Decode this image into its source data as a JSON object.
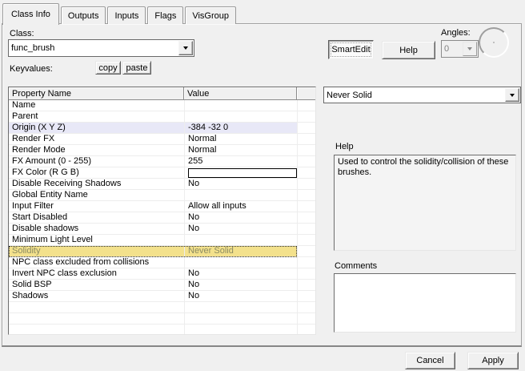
{
  "tabs": [
    {
      "label": "Class Info",
      "active": true
    },
    {
      "label": "Outputs",
      "active": false
    },
    {
      "label": "Inputs",
      "active": false
    },
    {
      "label": "Flags",
      "active": false
    },
    {
      "label": "VisGroup",
      "active": false
    }
  ],
  "class_section": {
    "label": "Class:",
    "value": "func_brush",
    "keyvalues_label": "Keyvalues:",
    "copy_label": "copy",
    "paste_label": "paste"
  },
  "toolbar": {
    "smartedit_label": "SmartEdit",
    "help_label": "Help",
    "angles_label": "Angles:",
    "angles_value": "0"
  },
  "property_table": {
    "columns": [
      "Property Name",
      "Value"
    ],
    "rows": [
      {
        "name": "Name",
        "value": ""
      },
      {
        "name": "Parent",
        "value": ""
      },
      {
        "name": "Origin (X Y Z)",
        "value": "-384 -32 0",
        "highlight": true
      },
      {
        "name": "Render FX",
        "value": "Normal"
      },
      {
        "name": "Render Mode",
        "value": "Normal"
      },
      {
        "name": "FX Amount (0 - 255)",
        "value": "255"
      },
      {
        "name": "FX Color (R G B)",
        "value": "",
        "color_swatch": true
      },
      {
        "name": "Disable Receiving Shadows",
        "value": "No"
      },
      {
        "name": "Global Entity Name",
        "value": ""
      },
      {
        "name": "Input Filter",
        "value": "Allow all inputs"
      },
      {
        "name": "Start Disabled",
        "value": "No"
      },
      {
        "name": "Disable shadows",
        "value": "No"
      },
      {
        "name": "Minimum Light Level",
        "value": ""
      },
      {
        "name": "Solidity",
        "value": "Never Solid",
        "selected": true
      },
      {
        "name": "NPC class excluded from collisions",
        "value": ""
      },
      {
        "name": "Invert NPC class exclusion",
        "value": "No"
      },
      {
        "name": "Solid BSP",
        "value": "No"
      },
      {
        "name": "Shadows",
        "value": "No"
      }
    ],
    "empty_filler_rows": 3
  },
  "value_editor": {
    "selected_value": "Never Solid"
  },
  "help_section": {
    "label": "Help",
    "text": "Used to control the solidity/collision of these brushes."
  },
  "comments_section": {
    "label": "Comments",
    "text": ""
  },
  "footer": {
    "cancel_label": "Cancel",
    "apply_label": "Apply"
  },
  "colors": {
    "selected_row_bg": "#f3e18c",
    "selected_row_text": "#8b8b62",
    "highlight_row_bg": "#e8e8f7",
    "dialog_bg": "#f0f0f0"
  }
}
